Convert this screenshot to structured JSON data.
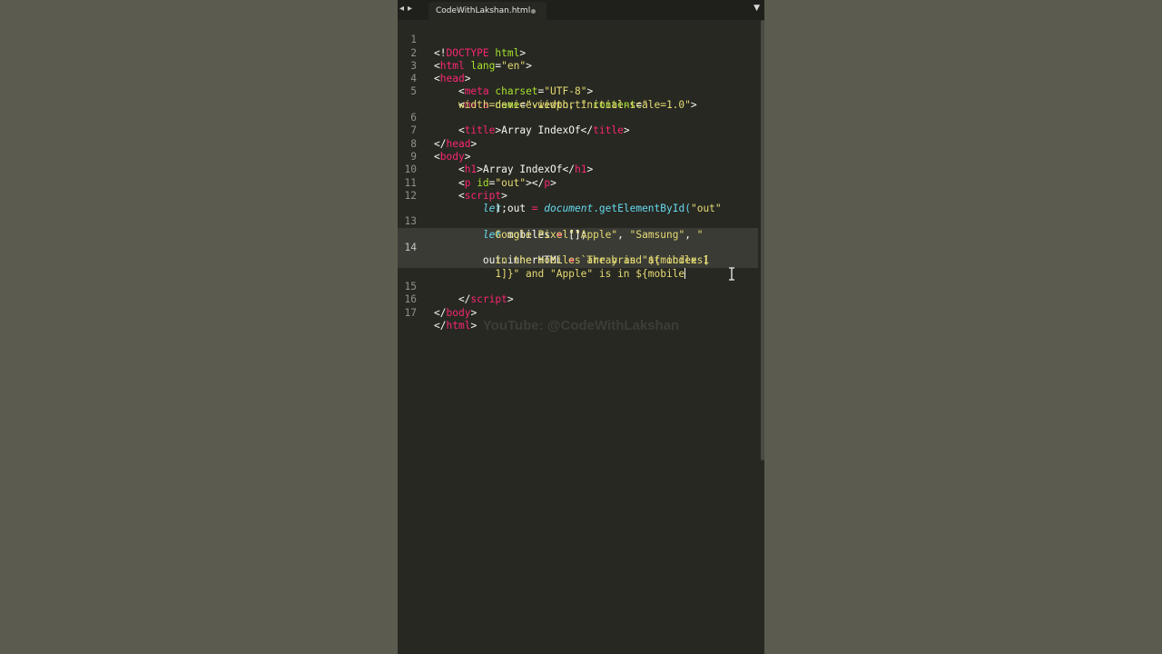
{
  "tab": {
    "filename": "CodeWithLakshan.html",
    "dirty_indicator": "•",
    "back_arrow": "◂",
    "forward_arrow": "▸",
    "dropdown": "▼"
  },
  "watermark": "YouTube: @CodeWithLakshan",
  "code": {
    "l1": {
      "n": "1",
      "p": [
        "<!",
        "DOCTYPE",
        " ",
        "html",
        ">"
      ]
    },
    "l2": {
      "n": "2",
      "p": [
        "<",
        "html",
        " ",
        "lang",
        "=",
        "\"en\"",
        ">"
      ]
    },
    "l3": {
      "n": "3",
      "p": [
        "<",
        "head",
        ">"
      ]
    },
    "l4": {
      "n": "4",
      "p": [
        "    <",
        "meta",
        " ",
        "charset",
        "=",
        "\"UTF-8\"",
        ">"
      ]
    },
    "l5": {
      "n": "5",
      "p": [
        "    <",
        "meta",
        " ",
        "name",
        "=",
        "\"viewport\"",
        " ",
        "content",
        "=",
        "\""
      ]
    },
    "l5b": {
      "p": [
        "    width=device-width, initial-scale=1.0\"",
        ">"
      ]
    },
    "l6": {
      "n": "6",
      "p": [
        "    <",
        "title",
        ">Array IndexOf</",
        "title",
        ">"
      ]
    },
    "l7": {
      "n": "7",
      "p": [
        "</",
        "head",
        ">"
      ]
    },
    "l8": {
      "n": "8",
      "p": [
        "<",
        "body",
        ">"
      ]
    },
    "l9": {
      "n": "9",
      "p": [
        "    <",
        "h1",
        ">Array IndexOf</",
        "h1",
        ">"
      ]
    },
    "l10": {
      "n": "10",
      "p": [
        "    <",
        "p",
        " ",
        "id",
        "=",
        "\"out\"",
        "></",
        "p",
        ">"
      ]
    },
    "l11": {
      "n": "11",
      "p": [
        "    <",
        "script",
        ">"
      ]
    },
    "l12": {
      "n": "12",
      "p": [
        "        ",
        "let",
        " out ",
        "=",
        " ",
        "document",
        ".getElementById(",
        "\"out\""
      ]
    },
    "l12b": {
      "p": [
        "          );"
      ]
    },
    "l13": {
      "n": "13",
      "p": [
        "        ",
        "let",
        " mobiles ",
        "=",
        " [",
        "\"Apple\"",
        ", ",
        "\"Samsung\"",
        ", ",
        "\""
      ]
    },
    "l13b": {
      "p": [
        "          Google Pixel\"",
        "];"
      ]
    },
    "l14": {
      "n": "14",
      "p": [
        "        out.innerHTML ",
        "=",
        " ",
        "`The brand at index 1"
      ]
    },
    "l14b": {
      "p": [
        "          in the mobiles array is \"${mobiles["
      ]
    },
    "l14c": {
      "p": [
        "          1]}\" and \"Apple\" is in ${mobile"
      ]
    },
    "l15": {
      "n": "15",
      "p": [
        "    </",
        "script",
        ">"
      ]
    },
    "l16": {
      "n": "16",
      "p": [
        "</",
        "body",
        ">"
      ]
    },
    "l17": {
      "n": "17",
      "p": [
        "</",
        "html",
        ">"
      ]
    }
  },
  "colors": {
    "background": "#272822",
    "tag": "#f92672",
    "attribute": "#a6e22e",
    "string": "#e6db74",
    "keyword": "#66d9ef",
    "text": "#f8f8f2"
  }
}
